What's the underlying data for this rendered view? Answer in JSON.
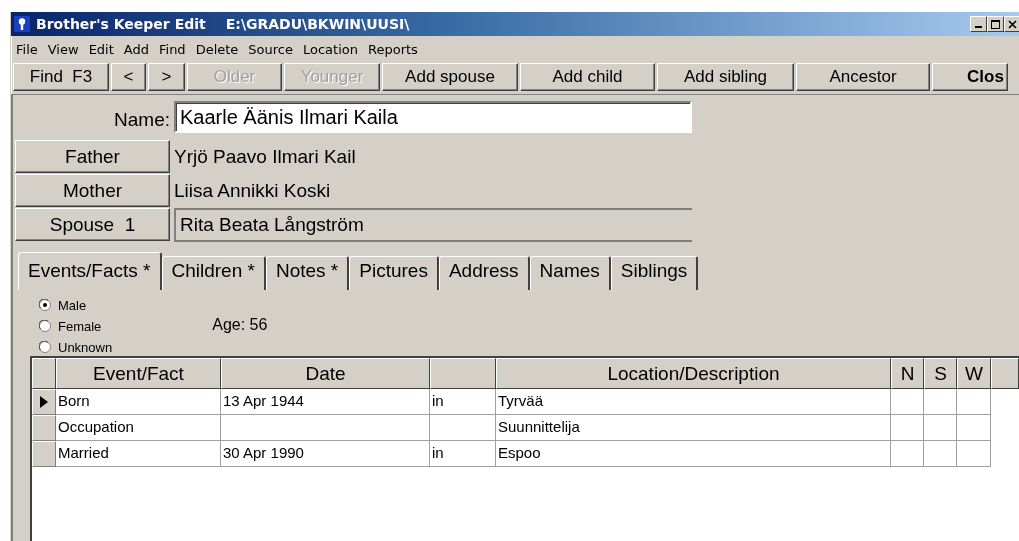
{
  "window": {
    "title": "Brother's Keeper Edit",
    "path": "E:\\GRADU\\BKWIN\\UUSI\\"
  },
  "menu": [
    "File",
    "View",
    "Edit",
    "Add",
    "Find",
    "Delete",
    "Source",
    "Location",
    "Reports"
  ],
  "toolbar": [
    {
      "label": "Find  F3",
      "disabled": false,
      "default": false
    },
    {
      "label": "<",
      "disabled": false,
      "default": false
    },
    {
      "label": ">",
      "disabled": false,
      "default": false
    },
    {
      "label": "Older",
      "disabled": true,
      "default": false
    },
    {
      "label": "Younger",
      "disabled": true,
      "default": false
    },
    {
      "label": "Add spouse",
      "disabled": false,
      "default": false
    },
    {
      "label": "Add child",
      "disabled": false,
      "default": false
    },
    {
      "label": "Add sibling",
      "disabled": false,
      "default": false
    },
    {
      "label": "Ancestor",
      "disabled": false,
      "default": false
    },
    {
      "label": "Clos",
      "disabled": false,
      "default": true
    }
  ],
  "person": {
    "name_label": "Name:",
    "name": "Kaarle Äänis Ilmari Kaila",
    "relations": [
      {
        "button": "Father",
        "value": "Yrjö Paavo Ilmari Kail",
        "kind": "text"
      },
      {
        "button": "Mother",
        "value": "Liisa Annikki Koski",
        "kind": "text"
      },
      {
        "button": "Spouse  1",
        "value": "Rita Beata Långström",
        "kind": "field"
      }
    ]
  },
  "tabs": [
    {
      "label": "Events/Facts *",
      "selected": true
    },
    {
      "label": "Children *",
      "selected": false
    },
    {
      "label": "Notes *",
      "selected": false
    },
    {
      "label": "Pictures",
      "selected": false
    },
    {
      "label": "Address",
      "selected": false
    },
    {
      "label": "Names",
      "selected": false
    },
    {
      "label": "Siblings",
      "selected": false
    }
  ],
  "sex": [
    {
      "label": "Male",
      "selected": true
    },
    {
      "label": "Female",
      "selected": false
    },
    {
      "label": "Unknown",
      "selected": false
    }
  ],
  "age": "Age: 56",
  "events": {
    "columns": [
      "Event/Fact",
      "Date",
      null,
      "Location/Description",
      "N",
      "S",
      "W"
    ],
    "rows": [
      {
        "event": "Born",
        "date": "13 Apr 1944",
        "prep": "in",
        "location": "Tyrvää",
        "selected": true
      },
      {
        "event": "Occupation",
        "location": "Suunnittelija",
        "selected": false
      },
      {
        "event": "Married",
        "date": "30 Apr 1990",
        "prep": "in",
        "location": "Espoo",
        "selected": false
      }
    ]
  }
}
